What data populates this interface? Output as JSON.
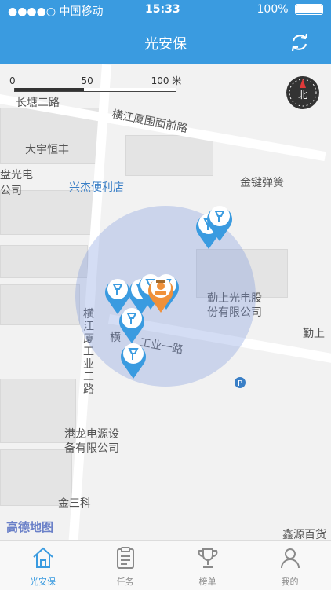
{
  "status": {
    "carrier": "●●●●○ 中国移动",
    "time": "15:33",
    "battery": "100%"
  },
  "nav": {
    "title": "光安保",
    "refresh_icon": "refresh-icon"
  },
  "map": {
    "scale": {
      "z0": "0",
      "z1": "50",
      "z2": "100 米"
    },
    "compass": "北",
    "logo": "高德地图",
    "labels": {
      "changtang": "长塘二路",
      "hengjiang_front": "横江厦围面前路",
      "dazi": "大宇恒丰",
      "guangdian": "盘光电",
      "gongsi": "公司",
      "xingjie": "兴杰便利店",
      "jinjian": "金键弹簧",
      "qinshang1": "勤上光电股",
      "qinshang2": "份有限公司",
      "qinshang_right": "勤上",
      "heng": "横",
      "gongye": "工业一路",
      "henggong": "横江厦工业二路",
      "ganglong1": "港龙电源设",
      "ganglong2": "备有限公司",
      "jinsanke": "金三科",
      "xinyuan": "鑫源百货"
    }
  },
  "tabs": [
    {
      "label": "光安保",
      "icon": "home-icon",
      "active": true
    },
    {
      "label": "任务",
      "icon": "clipboard-icon",
      "active": false
    },
    {
      "label": "榜单",
      "icon": "trophy-icon",
      "active": false
    },
    {
      "label": "我的",
      "icon": "user-icon",
      "active": false
    }
  ],
  "colors": {
    "primary": "#3a9be0",
    "pin": "#3a9be0",
    "guard_pin": "#f0913a"
  }
}
